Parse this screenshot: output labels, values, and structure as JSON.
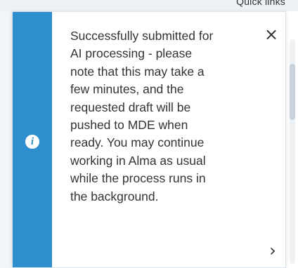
{
  "header": {
    "quick_links_label": "Quick links"
  },
  "notification": {
    "type": "info",
    "message": "Successfully submitted for\nAI processing - please\nnote that this may take a\nfew minutes, and the\nrequested draft will be\npushed to MDE when\nready. You may continue\nworking in Alma as usual\nwhile the process runs in\nthe background.",
    "close_icon": "×",
    "expand_icon": "›",
    "info_icon": "i"
  },
  "colors": {
    "accent": "#2f8fce",
    "text": "#333333",
    "background": "#ffffff"
  },
  "icons": {
    "info": "info-icon",
    "close": "close-icon",
    "expand": "chevron-right-icon"
  }
}
